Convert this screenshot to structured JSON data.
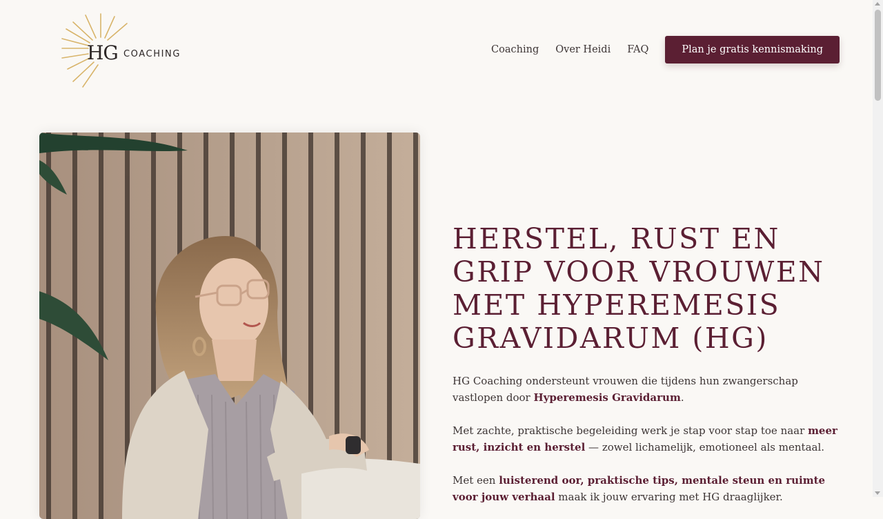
{
  "brand": {
    "logo_hg": "HG",
    "logo_coaching": "COACHING",
    "accent": "#5b1f33",
    "sun_color": "#d8b46a"
  },
  "nav": {
    "items": [
      "Coaching",
      "Over Heidi",
      "FAQ"
    ],
    "cta": "Plan je gratis kennismaking"
  },
  "hero": {
    "title": "HERSTEL, RUST EN GRIP VOOR VROUWEN MET HYPEREMESIS GRAVIDARUM (HG)",
    "p1_a": "HG Coaching ondersteunt vrouwen die tijdens hun zwangerschap vastlopen door ",
    "p1_b": "Hyperemesis Gravidarum",
    "p1_c": ".",
    "p2_a": "Met zachte, praktische begeleiding werk je stap voor stap toe naar ",
    "p2_b": "meer rust, inzicht en herstel",
    "p2_c": " — zowel lichamelijk, emotioneel als mentaal.",
    "p3_a": "Met een ",
    "p3_b": "luisterend oor, praktische tips, mentale steun en ruimte voor jouw verhaal",
    "p3_c": " maak ik jouw ervaring met HG draaglijker."
  },
  "icons": {
    "logo": "sun-rays-icon",
    "photo": "portrait-photo"
  }
}
